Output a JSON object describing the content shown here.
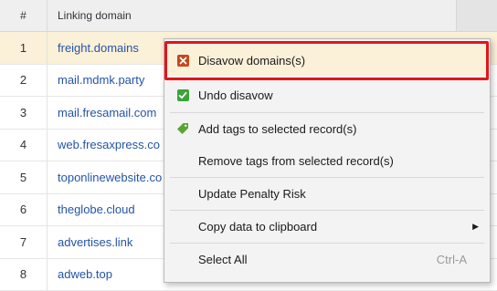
{
  "table": {
    "headers": {
      "number": "#",
      "domain": "Linking domain"
    },
    "rows": [
      {
        "num": "1",
        "domain": "freight.domains"
      },
      {
        "num": "2",
        "domain": "mail.mdmk.party"
      },
      {
        "num": "3",
        "domain": "mail.fresamail.com"
      },
      {
        "num": "4",
        "domain": "web.fresaxpress.co"
      },
      {
        "num": "5",
        "domain": "toponlinewebsite.co"
      },
      {
        "num": "6",
        "domain": "theglobe.cloud"
      },
      {
        "num": "7",
        "domain": "advertises.link"
      },
      {
        "num": "8",
        "domain": "adweb.top"
      }
    ]
  },
  "context_menu": {
    "items": [
      {
        "label": "Disavow domains(s)",
        "icon": "disavow-icon"
      },
      {
        "label": "Undo disavow",
        "icon": "check-icon"
      },
      {
        "label": "Add tags to selected record(s)",
        "icon": "tag-icon"
      },
      {
        "label": "Remove tags from selected record(s)"
      },
      {
        "label": "Update Penalty Risk"
      },
      {
        "label": "Copy data to clipboard",
        "submenu": true
      },
      {
        "label": "Select All",
        "shortcut": "Ctrl-A"
      }
    ]
  },
  "colors": {
    "selection": "#fbf0d8",
    "link": "#2454a6",
    "highlight_outline": "#e4141b",
    "disavow_icon": "#c8461c",
    "check_icon": "#3aa33a",
    "tag_icon": "#5aa532"
  }
}
